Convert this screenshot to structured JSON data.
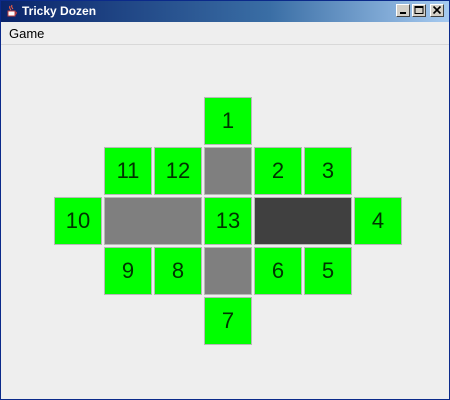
{
  "window": {
    "title": "Tricky Dozen",
    "controls": {
      "minimize": "_",
      "maximize": "□",
      "close": "×"
    }
  },
  "menu": {
    "items": [
      "Game"
    ]
  },
  "board": {
    "tiles": [
      "1",
      "2",
      "3",
      "4",
      "5",
      "6",
      "7",
      "8",
      "9",
      "10",
      "11",
      "12",
      "13"
    ],
    "colors": {
      "tile": "#00ff00",
      "tile_text": "#003300",
      "empty_light": "#7f7f7f",
      "empty_dark": "#404040",
      "background": "#eeeeee"
    }
  }
}
